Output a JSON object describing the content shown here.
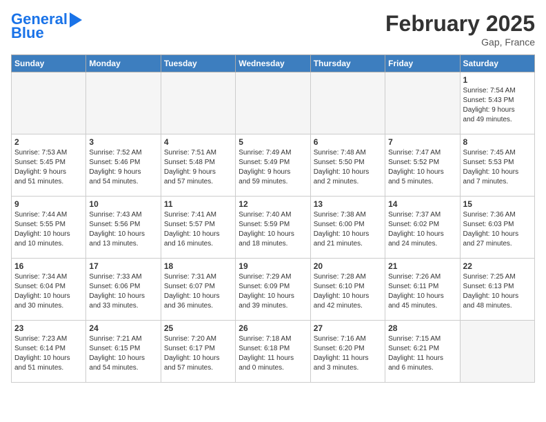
{
  "header": {
    "logo_line1": "General",
    "logo_line2": "Blue",
    "month": "February 2025",
    "location": "Gap, France"
  },
  "columns": [
    "Sunday",
    "Monday",
    "Tuesday",
    "Wednesday",
    "Thursday",
    "Friday",
    "Saturday"
  ],
  "weeks": [
    [
      {
        "num": "",
        "info": "",
        "empty": true
      },
      {
        "num": "",
        "info": "",
        "empty": true
      },
      {
        "num": "",
        "info": "",
        "empty": true
      },
      {
        "num": "",
        "info": "",
        "empty": true
      },
      {
        "num": "",
        "info": "",
        "empty": true
      },
      {
        "num": "",
        "info": "",
        "empty": true
      },
      {
        "num": "1",
        "info": "Sunrise: 7:54 AM\nSunset: 5:43 PM\nDaylight: 9 hours\nand 49 minutes."
      }
    ],
    [
      {
        "num": "2",
        "info": "Sunrise: 7:53 AM\nSunset: 5:45 PM\nDaylight: 9 hours\nand 51 minutes."
      },
      {
        "num": "3",
        "info": "Sunrise: 7:52 AM\nSunset: 5:46 PM\nDaylight: 9 hours\nand 54 minutes."
      },
      {
        "num": "4",
        "info": "Sunrise: 7:51 AM\nSunset: 5:48 PM\nDaylight: 9 hours\nand 57 minutes."
      },
      {
        "num": "5",
        "info": "Sunrise: 7:49 AM\nSunset: 5:49 PM\nDaylight: 9 hours\nand 59 minutes."
      },
      {
        "num": "6",
        "info": "Sunrise: 7:48 AM\nSunset: 5:50 PM\nDaylight: 10 hours\nand 2 minutes."
      },
      {
        "num": "7",
        "info": "Sunrise: 7:47 AM\nSunset: 5:52 PM\nDaylight: 10 hours\nand 5 minutes."
      },
      {
        "num": "8",
        "info": "Sunrise: 7:45 AM\nSunset: 5:53 PM\nDaylight: 10 hours\nand 7 minutes."
      }
    ],
    [
      {
        "num": "9",
        "info": "Sunrise: 7:44 AM\nSunset: 5:55 PM\nDaylight: 10 hours\nand 10 minutes."
      },
      {
        "num": "10",
        "info": "Sunrise: 7:43 AM\nSunset: 5:56 PM\nDaylight: 10 hours\nand 13 minutes."
      },
      {
        "num": "11",
        "info": "Sunrise: 7:41 AM\nSunset: 5:57 PM\nDaylight: 10 hours\nand 16 minutes."
      },
      {
        "num": "12",
        "info": "Sunrise: 7:40 AM\nSunset: 5:59 PM\nDaylight: 10 hours\nand 18 minutes."
      },
      {
        "num": "13",
        "info": "Sunrise: 7:38 AM\nSunset: 6:00 PM\nDaylight: 10 hours\nand 21 minutes."
      },
      {
        "num": "14",
        "info": "Sunrise: 7:37 AM\nSunset: 6:02 PM\nDaylight: 10 hours\nand 24 minutes."
      },
      {
        "num": "15",
        "info": "Sunrise: 7:36 AM\nSunset: 6:03 PM\nDaylight: 10 hours\nand 27 minutes."
      }
    ],
    [
      {
        "num": "16",
        "info": "Sunrise: 7:34 AM\nSunset: 6:04 PM\nDaylight: 10 hours\nand 30 minutes."
      },
      {
        "num": "17",
        "info": "Sunrise: 7:33 AM\nSunset: 6:06 PM\nDaylight: 10 hours\nand 33 minutes."
      },
      {
        "num": "18",
        "info": "Sunrise: 7:31 AM\nSunset: 6:07 PM\nDaylight: 10 hours\nand 36 minutes."
      },
      {
        "num": "19",
        "info": "Sunrise: 7:29 AM\nSunset: 6:09 PM\nDaylight: 10 hours\nand 39 minutes."
      },
      {
        "num": "20",
        "info": "Sunrise: 7:28 AM\nSunset: 6:10 PM\nDaylight: 10 hours\nand 42 minutes."
      },
      {
        "num": "21",
        "info": "Sunrise: 7:26 AM\nSunset: 6:11 PM\nDaylight: 10 hours\nand 45 minutes."
      },
      {
        "num": "22",
        "info": "Sunrise: 7:25 AM\nSunset: 6:13 PM\nDaylight: 10 hours\nand 48 minutes."
      }
    ],
    [
      {
        "num": "23",
        "info": "Sunrise: 7:23 AM\nSunset: 6:14 PM\nDaylight: 10 hours\nand 51 minutes."
      },
      {
        "num": "24",
        "info": "Sunrise: 7:21 AM\nSunset: 6:15 PM\nDaylight: 10 hours\nand 54 minutes."
      },
      {
        "num": "25",
        "info": "Sunrise: 7:20 AM\nSunset: 6:17 PM\nDaylight: 10 hours\nand 57 minutes."
      },
      {
        "num": "26",
        "info": "Sunrise: 7:18 AM\nSunset: 6:18 PM\nDaylight: 11 hours\nand 0 minutes."
      },
      {
        "num": "27",
        "info": "Sunrise: 7:16 AM\nSunset: 6:20 PM\nDaylight: 11 hours\nand 3 minutes."
      },
      {
        "num": "28",
        "info": "Sunrise: 7:15 AM\nSunset: 6:21 PM\nDaylight: 11 hours\nand 6 minutes."
      },
      {
        "num": "",
        "info": "",
        "empty": true
      }
    ]
  ]
}
